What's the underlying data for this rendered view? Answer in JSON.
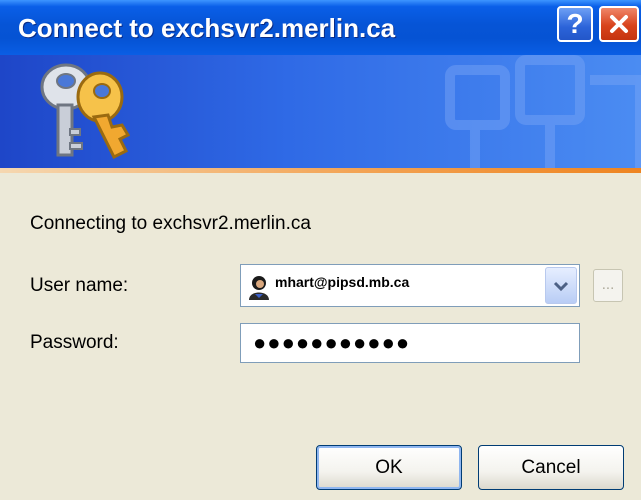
{
  "window": {
    "title": "Connect to exchsvr2.merlin.ca",
    "help_label": "?"
  },
  "body": {
    "connecting_text": "Connecting to exchsvr2.merlin.ca"
  },
  "form": {
    "username_label": "User name:",
    "username_value": "mhart@pipsd.mb.ca",
    "browse_label": "...",
    "password_label": "Password:",
    "password_masked": "●●●●●●●●●●●"
  },
  "buttons": {
    "ok": "OK",
    "cancel": "Cancel"
  },
  "icons": {
    "banner": "keys-icon",
    "user": "user-icon",
    "dropdown": "chevron-down-icon",
    "close": "close-icon",
    "help": "help-icon"
  },
  "colors": {
    "titlebar": "#0654d6",
    "banner_accent": "#ee8420",
    "dialog_bg": "#ece9d8"
  }
}
